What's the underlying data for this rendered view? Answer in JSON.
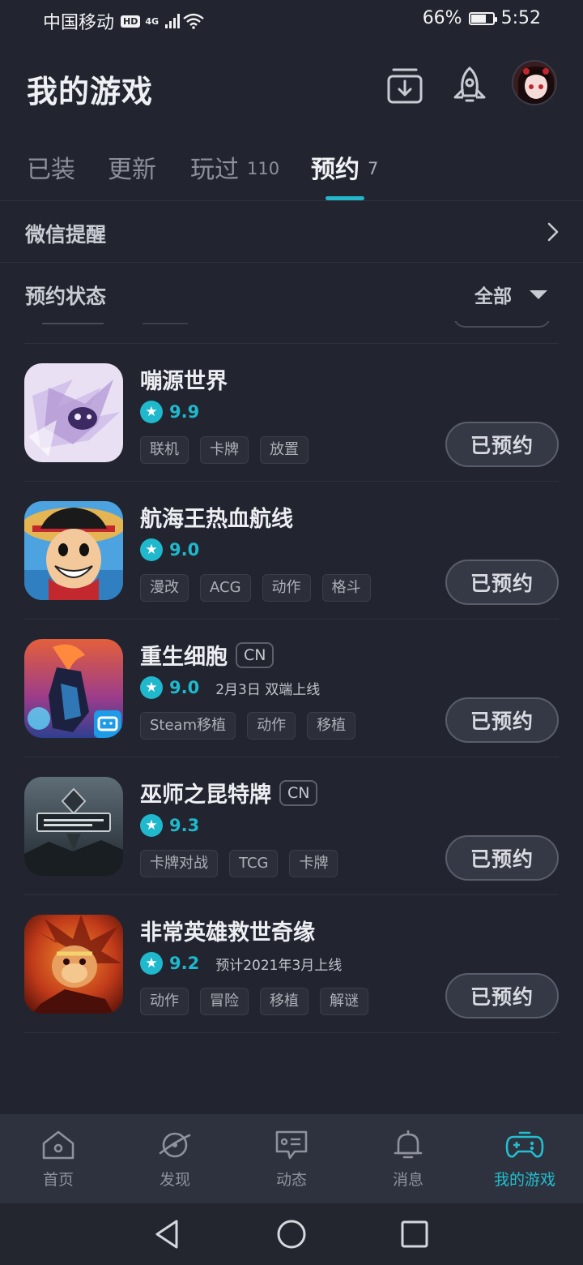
{
  "status_bar": {
    "carrier": "中国移动",
    "hd": "HD",
    "network": "4G",
    "battery": "66%",
    "time": "5:52"
  },
  "header": {
    "title": "我的游戏",
    "icons": [
      "download-icon",
      "rocket-icon",
      "avatar"
    ]
  },
  "tabs": [
    {
      "label": "已装",
      "count": ""
    },
    {
      "label": "更新",
      "count": ""
    },
    {
      "label": "玩过",
      "count": "110"
    },
    {
      "label": "预约",
      "count": "7",
      "active": true
    }
  ],
  "wechat_reminder": {
    "label": "微信提醒"
  },
  "reservation_status": {
    "label": "预约状态",
    "filter": "全部"
  },
  "games": [
    {
      "name": "嘣源世界",
      "badge": "",
      "score": "9.9",
      "note": "",
      "tags": [
        "联机",
        "卡牌",
        "放置"
      ],
      "button": "已预约"
    },
    {
      "name": "航海王热血航线",
      "badge": "",
      "score": "9.0",
      "note": "",
      "tags": [
        "漫改",
        "ACG",
        "动作",
        "格斗"
      ],
      "button": "已预约"
    },
    {
      "name": "重生细胞",
      "badge": "CN",
      "score": "9.0",
      "note": "2月3日 双端上线",
      "tags": [
        "Steam移植",
        "动作",
        "移植"
      ],
      "button": "已预约"
    },
    {
      "name": "巫师之昆特牌",
      "badge": "CN",
      "score": "9.3",
      "note": "",
      "tags": [
        "卡牌对战",
        "TCG",
        "卡牌"
      ],
      "button": "已预约"
    },
    {
      "name": "非常英雄救世奇缘",
      "badge": "",
      "score": "9.2",
      "note": "预计2021年3月上线",
      "tags": [
        "动作",
        "冒险",
        "移植",
        "解谜"
      ],
      "button": "已预约"
    }
  ],
  "bottom_nav": [
    {
      "label": "首页",
      "icon": "home-icon"
    },
    {
      "label": "发现",
      "icon": "planet-icon"
    },
    {
      "label": "动态",
      "icon": "chat-card-icon"
    },
    {
      "label": "消息",
      "icon": "bell-icon"
    },
    {
      "label": "我的游戏",
      "icon": "gamepad-icon",
      "active": true
    }
  ],
  "colors": {
    "background": "#222530",
    "accent": "#22b8c9",
    "nav_bg": "#2e323e"
  }
}
